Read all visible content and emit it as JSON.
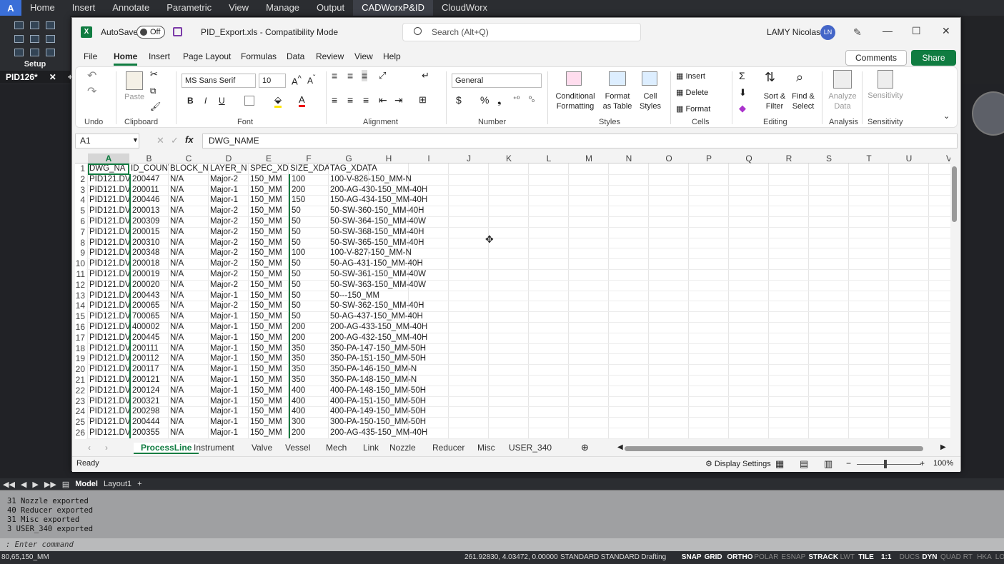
{
  "cad": {
    "menu_tabs": [
      "Home",
      "Insert",
      "Annotate",
      "Parametric",
      "View",
      "Manage",
      "Output",
      "CADWorxP&ID",
      "CloudWorx"
    ],
    "logo": "A",
    "setup_label": "Setup",
    "doc_tab": "PID126*",
    "layout_tabs": [
      "Model",
      "Layout1",
      "+"
    ],
    "command_history": [
      "31 Nozzle exported",
      "40 Reducer exported",
      "31 Misc exported",
      "3 USER_340 exported"
    ],
    "command_prompt": ": Enter command",
    "status_left": "80,65,150_MM",
    "coords": "261.92830, 4.03472, 0.00000",
    "status_items": [
      "STANDARD",
      "STANDARD",
      "Drafting",
      "SNAP",
      "GRID",
      "ORTHO",
      "POLAR",
      "ESNAP",
      "STRACK",
      "LWT",
      "TILE",
      "1:1",
      "DUCS",
      "DYN",
      "QUAD",
      "RT",
      "HKA",
      "LOCKUI"
    ]
  },
  "excel": {
    "autosave_label": "AutoSave",
    "autosave_state": "Off",
    "filename": "PID_Export.xls - Compatibility Mode",
    "search_placeholder": "Search (Alt+Q)",
    "user_name": "LAMY Nicolas",
    "user_initials": "LN",
    "ribbon_tabs": [
      "File",
      "Home",
      "Insert",
      "Page Layout",
      "Formulas",
      "Data",
      "Review",
      "View",
      "Help"
    ],
    "comments_label": "Comments",
    "share_label": "Share",
    "ribbon": {
      "groups": [
        "Undo",
        "Clipboard",
        "Font",
        "Alignment",
        "Number",
        "Styles",
        "Cells",
        "Editing",
        "Analysis",
        "Sensitivity"
      ],
      "paste": "Paste",
      "font_name": "MS Sans Serif",
      "font_size": "10",
      "number_format": "General",
      "conditional_formatting": "Conditional Formatting",
      "format_as_table": "Format as Table",
      "cell_styles": "Cell Styles",
      "insert": "Insert",
      "delete": "Delete",
      "format": "Format",
      "sort_filter": "Sort & Filter",
      "find_select": "Find & Select",
      "analyze_data": "Analyze Data",
      "sensitivity": "Sensitivity"
    },
    "name_box": "A1",
    "fx": "fx",
    "formula": "DWG_NAME",
    "columns": [
      "A",
      "B",
      "C",
      "D",
      "E",
      "F",
      "G",
      "H",
      "I",
      "J",
      "K",
      "L",
      "M",
      "N",
      "O",
      "P",
      "Q",
      "R",
      "S",
      "T",
      "U",
      "V"
    ],
    "rows": [
      [
        "DWG_NA",
        "ID_COUNT",
        "BLOCK_N",
        "LAYER_N",
        "SPEC_XD",
        "SIZE_XDA",
        "TAG_XDATA"
      ],
      [
        "PID121.DV",
        "200447",
        "N/A",
        "Major-2",
        "150_MM",
        "100",
        "100-V-826-150_MM-N"
      ],
      [
        "PID121.DV",
        "200011",
        "N/A",
        "Major-1",
        "150_MM",
        "200",
        "200-AG-430-150_MM-40H"
      ],
      [
        "PID121.DV",
        "200446",
        "N/A",
        "Major-1",
        "150_MM",
        "150",
        "150-AG-434-150_MM-40H"
      ],
      [
        "PID121.DV",
        "200013",
        "N/A",
        "Major-2",
        "150_MM",
        "50",
        "50-SW-360-150_MM-40H"
      ],
      [
        "PID121.DV",
        "200309",
        "N/A",
        "Major-2",
        "150_MM",
        "50",
        "50-SW-364-150_MM-40W"
      ],
      [
        "PID121.DV",
        "200015",
        "N/A",
        "Major-2",
        "150_MM",
        "50",
        "50-SW-368-150_MM-40H"
      ],
      [
        "PID121.DV",
        "200310",
        "N/A",
        "Major-2",
        "150_MM",
        "50",
        "50-SW-365-150_MM-40H"
      ],
      [
        "PID121.DV",
        "200348",
        "N/A",
        "Major-2",
        "150_MM",
        "100",
        "100-V-827-150_MM-N"
      ],
      [
        "PID121.DV",
        "200018",
        "N/A",
        "Major-2",
        "150_MM",
        "50",
        "50-AG-431-150_MM-40H"
      ],
      [
        "PID121.DV",
        "200019",
        "N/A",
        "Major-2",
        "150_MM",
        "50",
        "50-SW-361-150_MM-40W"
      ],
      [
        "PID121.DV",
        "200020",
        "N/A",
        "Major-2",
        "150_MM",
        "50",
        "50-SW-363-150_MM-40W"
      ],
      [
        "PID121.DV",
        "200443",
        "N/A",
        "Major-1",
        "150_MM",
        "50",
        "50---150_MM"
      ],
      [
        "PID121.DV",
        "200065",
        "N/A",
        "Major-2",
        "150_MM",
        "50",
        "50-SW-362-150_MM-40H"
      ],
      [
        "PID121.DV",
        "700065",
        "N/A",
        "Major-1",
        "150_MM",
        "50",
        "50-AG-437-150_MM-40H"
      ],
      [
        "PID121.DV",
        "400002",
        "N/A",
        "Major-1",
        "150_MM",
        "200",
        "200-AG-433-150_MM-40H"
      ],
      [
        "PID121.DV",
        "200445",
        "N/A",
        "Major-1",
        "150_MM",
        "200",
        "200-AG-432-150_MM-40H"
      ],
      [
        "PID121.DV",
        "200111",
        "N/A",
        "Major-1",
        "150_MM",
        "350",
        "350-PA-147-150_MM-50H"
      ],
      [
        "PID121.DV",
        "200112",
        "N/A",
        "Major-1",
        "150_MM",
        "350",
        "350-PA-151-150_MM-50H"
      ],
      [
        "PID121.DV",
        "200117",
        "N/A",
        "Major-1",
        "150_MM",
        "350",
        "350-PA-146-150_MM-N"
      ],
      [
        "PID121.DV",
        "200121",
        "N/A",
        "Major-1",
        "150_MM",
        "350",
        "350-PA-148-150_MM-N"
      ],
      [
        "PID121.DV",
        "200124",
        "N/A",
        "Major-1",
        "150_MM",
        "400",
        "400-PA-148-150_MM-50H"
      ],
      [
        "PID121.DV",
        "200321",
        "N/A",
        "Major-1",
        "150_MM",
        "400",
        "400-PA-151-150_MM-50H"
      ],
      [
        "PID121.DV",
        "200298",
        "N/A",
        "Major-1",
        "150_MM",
        "400",
        "400-PA-149-150_MM-50H"
      ],
      [
        "PID121.DV",
        "200444",
        "N/A",
        "Major-1",
        "150_MM",
        "300",
        "300-PA-150-150_MM-50H"
      ],
      [
        "PID121.DV",
        "200355",
        "N/A",
        "Major-1",
        "150_MM",
        "200",
        "200-AG-435-150_MM-40H"
      ]
    ],
    "sheet_tabs": [
      "ProcessLine",
      "Instrument",
      "Valve",
      "Vessel",
      "Mech",
      "Link",
      "Nozzle",
      "Reducer",
      "Misc",
      "USER_340"
    ],
    "active_sheet": "ProcessLine",
    "status_ready": "Ready",
    "display_settings": "Display Settings",
    "zoom": "100%"
  }
}
